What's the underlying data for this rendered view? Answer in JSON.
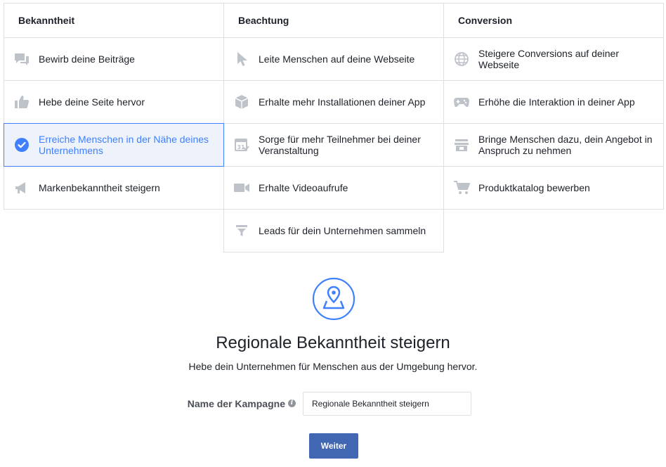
{
  "columns": [
    {
      "header": "Bekanntheit",
      "items": [
        {
          "label": "Bewirb deine Beiträge",
          "icon": "chat-bubbles-icon"
        },
        {
          "label": "Hebe deine Seite hervor",
          "icon": "thumbs-up-icon"
        },
        {
          "label": "Erreiche Menschen in der Nähe deines Unternehmens",
          "icon": "check-circle-icon",
          "selected": true
        },
        {
          "label": "Markenbekanntheit steigern",
          "icon": "megaphone-icon"
        }
      ]
    },
    {
      "header": "Beachtung",
      "items": [
        {
          "label": "Leite Menschen auf deine Webseite",
          "icon": "cursor-icon"
        },
        {
          "label": "Erhalte mehr Installationen deiner App",
          "icon": "box-icon"
        },
        {
          "label": "Sorge für mehr Teilnehmer bei deiner Veranstaltung",
          "icon": "calendar-icon"
        },
        {
          "label": "Erhalte Videoaufrufe",
          "icon": "video-camera-icon"
        },
        {
          "label": "Leads für dein Unternehmen sammeln",
          "icon": "funnel-icon"
        }
      ]
    },
    {
      "header": "Conversion",
      "items": [
        {
          "label": "Steigere Conversions auf deiner Webseite",
          "icon": "globe-icon"
        },
        {
          "label": "Erhöhe die Interaktion in deiner App",
          "icon": "gamepad-icon"
        },
        {
          "label": "Bringe Menschen dazu, dein Angebot in Anspruch zu nehmen",
          "icon": "storefront-icon"
        },
        {
          "label": "Produktkatalog bewerben",
          "icon": "shopping-cart-icon"
        }
      ]
    }
  ],
  "detail": {
    "icon": "location-pin-icon",
    "title": "Regionale Bekanntheit steigern",
    "subtitle": "Hebe dein Unternehmen für Menschen aus der Umgebung hervor."
  },
  "form": {
    "campaign_name_label": "Name der Kampagne",
    "info_icon": "info-icon",
    "info_glyph": "i",
    "campaign_name_value": "Regionale Bekanntheit steigern",
    "continue_label": "Weiter"
  },
  "colors": {
    "accent": "#4080ff",
    "selected_bg": "#edf2fb",
    "button": "#4267b2",
    "icon_gray": "#bec3c9",
    "border": "#dddfe2"
  }
}
